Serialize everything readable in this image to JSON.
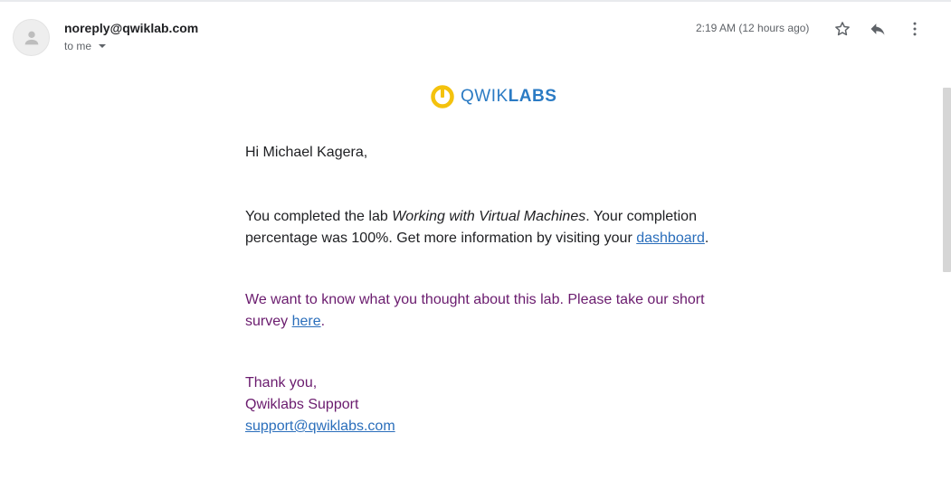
{
  "header": {
    "sender": "noreply@qwiklab.com",
    "recipient_label": "to me",
    "timestamp": "2:19 AM (12 hours ago)"
  },
  "icons": {
    "avatar": "person-icon",
    "star": "star-icon",
    "reply": "reply-icon",
    "more": "more-vert-icon"
  },
  "logo": {
    "text_light": "QWIK",
    "text_bold": "LABS",
    "ring_color": "#f4c20d",
    "text_color": "#2b7bc4"
  },
  "email": {
    "greeting": "Hi Michael Kagera,",
    "completion_prefix": "You completed the lab ",
    "lab_name": "Working with Virtual Machines",
    "completion_suffix": ". Your completion percentage was 100%. Get more information by visiting your ",
    "dashboard_link": "dashboard",
    "period": ".",
    "survey_prefix": "We want to know what you thought about this lab. Please take our short survey ",
    "survey_link": "here",
    "survey_period": ".",
    "thanks": "Thank you,",
    "team": "Qwiklabs Support",
    "support_email": "support@qwiklabs.com"
  },
  "colors": {
    "body_text": "#202124",
    "purple_text": "#6a1b6e",
    "link": "#2a6ebb"
  }
}
